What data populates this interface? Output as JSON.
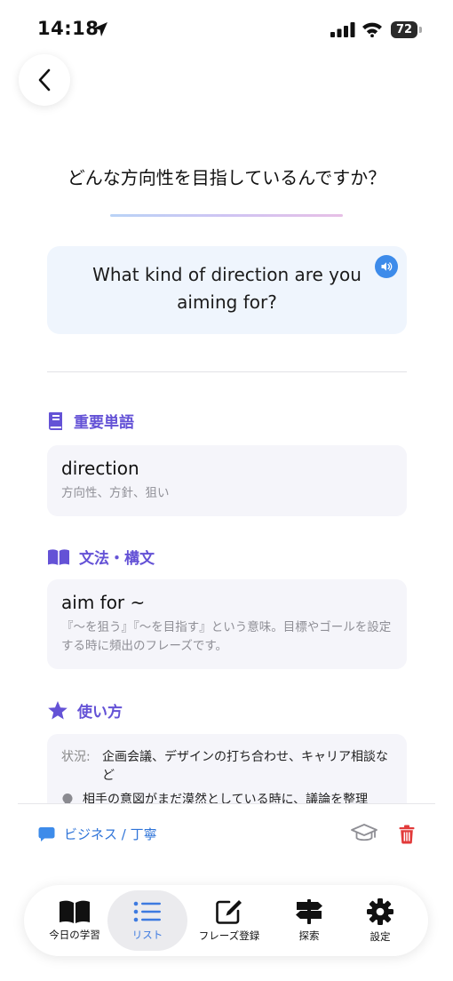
{
  "status": {
    "time": "14:18",
    "battery": "72"
  },
  "phrase": {
    "japanese": "どんな方向性を目指しているんですか？",
    "english": "What kind of direction are you aiming for?"
  },
  "sections": {
    "vocab": {
      "title": "重要単語",
      "word": "direction",
      "meaning": "方向性、方針、狙い"
    },
    "grammar": {
      "title": "文法・構文",
      "pattern": "aim for ~",
      "explanation": "『〜を狙う』『〜を目指す』という意味。目標やゴールを設定する時に頻出のフレーズです。"
    },
    "usage": {
      "title": "使い方",
      "situation_label": "状況:",
      "situation": "企画会議、デザインの打ち合わせ、キャリア相談など",
      "tip": "相手の意図がまだ漠然としている時に、議論を整理"
    }
  },
  "footer": {
    "tag": "ビジネス / 丁寧"
  },
  "tabs": [
    {
      "label": "今日の学習",
      "icon": "book-icon"
    },
    {
      "label": "リスト",
      "icon": "list-icon"
    },
    {
      "label": "フレーズ登録",
      "icon": "edit-icon"
    },
    {
      "label": "探索",
      "icon": "signpost-icon"
    },
    {
      "label": "設定",
      "icon": "gear-icon"
    }
  ],
  "colors": {
    "accent": "#6452d6",
    "blue": "#3d8bea",
    "delete": "#e23a3a"
  }
}
